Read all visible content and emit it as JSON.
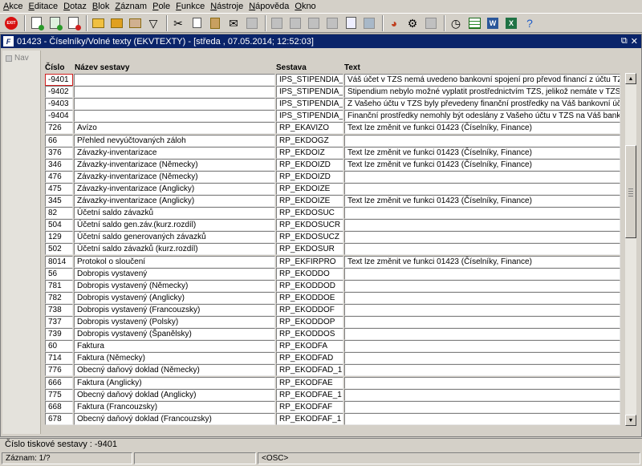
{
  "menu": [
    {
      "u": "A",
      "rest": "kce"
    },
    {
      "u": "E",
      "rest": "ditace"
    },
    {
      "u": "D",
      "rest": "otaz"
    },
    {
      "u": "B",
      "rest": "lok"
    },
    {
      "u": "Z",
      "rest": "áznam"
    },
    {
      "u": "P",
      "rest": "ole"
    },
    {
      "u": "F",
      "rest": "unkce"
    },
    {
      "u": "N",
      "rest": "ástroje"
    },
    {
      "u": "N",
      "rest": "ápověda"
    },
    {
      "u": "O",
      "rest": "kno"
    }
  ],
  "toolbar": {
    "exit_label": "EXIT",
    "icons": [
      "new-record-icon",
      "save-record-icon",
      "delete-record-icon",
      "enter-query-icon",
      "execute-query-icon",
      "cancel-query-icon",
      "filter-icon",
      "cut-icon",
      "copy-icon",
      "paste-icon",
      "email-icon",
      "disabled-icon",
      "disabled-icon",
      "disabled-icon",
      "disabled-icon",
      "disabled-icon",
      "print-preview-icon",
      "calculator-icon",
      "pie-chart-icon",
      "gear-icon",
      "disabled-icon",
      "clock-icon",
      "grid-icon",
      "word-icon",
      "excel-icon",
      "help-icon"
    ]
  },
  "window": {
    "title": "01423 - Číselníky/Volné texty (EKVTEXTY) - [středa , 07.05.2014; 12:52:03]",
    "app_icon": "F",
    "controls": [
      "⧉",
      "✕"
    ]
  },
  "nav": {
    "label": "Nav"
  },
  "columns": {
    "cislo": "Číslo",
    "nazev": "Název sestavy",
    "sestava": "Sestava",
    "text": "Text"
  },
  "rows": [
    {
      "cislo": "-9401",
      "nazev": "",
      "sestava": "IPS_STIPENDIA_MAIL",
      "text": "Váš účet v TZS nemá uvedeno bankovní spojení pro převod financí z účtu TZS na Váš b"
    },
    {
      "cislo": "-9402",
      "nazev": "",
      "sestava": "IPS_STIPENDIA_MAIL",
      "text": "Stipendium nebylo možné vyplatit prostřednictvím TZS, jelikož nemáte v TZS uvedeno bar"
    },
    {
      "cislo": "-9403",
      "nazev": "",
      "sestava": "IPS_STIPENDIA_MAIL",
      "text": "Z Vašeho účtu v TZS byly převedeny finanční prostředky na Váš bankovní účet.<BR><B"
    },
    {
      "cislo": "-9404",
      "nazev": "",
      "sestava": "IPS_STIPENDIA_MAIL",
      "text": "Finanční prostředky nemohly být odeslány z Vašeho účtu v TZS na Váš bankovní účet -"
    },
    {
      "cislo": "726",
      "nazev": "Avízo",
      "sestava": "RP_EKAVIZO",
      "text": "Text lze změnit ve funkci 01423 (Číselníky, Finance)"
    },
    {
      "cislo": "66",
      "nazev": "Přehled nevyúčtovaných záloh",
      "sestava": "RP_EKDOGZ",
      "text": ""
    },
    {
      "cislo": "376",
      "nazev": "Závazky-inventarizace",
      "sestava": "RP_EKDOIZ",
      "text": "Text lze změnit ve funkci 01423 (Číselníky, Finance)"
    },
    {
      "cislo": "346",
      "nazev": "Závazky-inventarizace (Německy)",
      "sestava": "RP_EKDOIZD",
      "text": "Text lze změnit ve funkci 01423 (Číselníky, Finance)"
    },
    {
      "cislo": "476",
      "nazev": "Závazky-inventarizace (Německy)",
      "sestava": "RP_EKDOIZD",
      "text": ""
    },
    {
      "cislo": "475",
      "nazev": "Závazky-inventarizace (Anglicky)",
      "sestava": "RP_EKDOIZE",
      "text": ""
    },
    {
      "cislo": "345",
      "nazev": "Závazky-inventarizace (Anglicky)",
      "sestava": "RP_EKDOIZE",
      "text": "Text lze změnit ve funkci 01423 (Číselníky, Finance)"
    },
    {
      "cislo": "82",
      "nazev": "Účetní saldo závazků",
      "sestava": "RP_EKDOSUC",
      "text": ""
    },
    {
      "cislo": "504",
      "nazev": "Účetní saldo gen.záv.(kurz.rozdíl)",
      "sestava": "RP_EKDOSUCR",
      "text": ""
    },
    {
      "cislo": "129",
      "nazev": "Účetní saldo generovaných závazků",
      "sestava": "RP_EKDOSUCZ",
      "text": ""
    },
    {
      "cislo": "502",
      "nazev": "Účetní saldo závazků (kurz.rozdíl)",
      "sestava": "RP_EKDOSUR",
      "text": ""
    },
    {
      "cislo": "8014",
      "nazev": "Protokol o sloučení",
      "sestava": "RP_EKFIRPRO",
      "text": "Text lze změnit ve funkci 01423 (Číselníky, Finance)"
    },
    {
      "cislo": "56",
      "nazev": "Dobropis vystavený",
      "sestava": "RP_EKODDO",
      "text": ""
    },
    {
      "cislo": "781",
      "nazev": "Dobropis vystavený (Německy)",
      "sestava": "RP_EKODDOD",
      "text": ""
    },
    {
      "cislo": "782",
      "nazev": "Dobropis vystavený (Anglicky)",
      "sestava": "RP_EKODDOE",
      "text": ""
    },
    {
      "cislo": "738",
      "nazev": "Dobropis vystavený (Francouzsky)",
      "sestava": "RP_EKODDOF",
      "text": ""
    },
    {
      "cislo": "737",
      "nazev": "Dobropis vystavený (Polsky)",
      "sestava": "RP_EKODDOP",
      "text": ""
    },
    {
      "cislo": "739",
      "nazev": "Dobropis vystavený (Španělsky)",
      "sestava": "RP_EKODDOS",
      "text": ""
    },
    {
      "cislo": "60",
      "nazev": "Faktura",
      "sestava": "RP_EKODFA",
      "text": ""
    },
    {
      "cislo": "714",
      "nazev": "Faktura (Německy)",
      "sestava": "RP_EKODFAD",
      "text": ""
    },
    {
      "cislo": "776",
      "nazev": "Obecný daňový doklad (Německy)",
      "sestava": "RP_EKODFAD_1",
      "text": ""
    },
    {
      "cislo": "666",
      "nazev": "Faktura (Anglicky)",
      "sestava": "RP_EKODFAE",
      "text": ""
    },
    {
      "cislo": "775",
      "nazev": "Obecný daňový doklad (Anglicky)",
      "sestava": "RP_EKODFAE_1",
      "text": ""
    },
    {
      "cislo": "668",
      "nazev": "Faktura (Francouzsky)",
      "sestava": "RP_EKODFAF",
      "text": ""
    },
    {
      "cislo": "678",
      "nazev": "Obecný daňový doklad (Francouzsky)",
      "sestava": "RP_EKODFAF_1",
      "text": ""
    }
  ],
  "status": {
    "hint": "Číslo tiskové sestavy : -9401",
    "record": "Záznam: 1/?",
    "empty": "",
    "mode": "<OSC>"
  }
}
